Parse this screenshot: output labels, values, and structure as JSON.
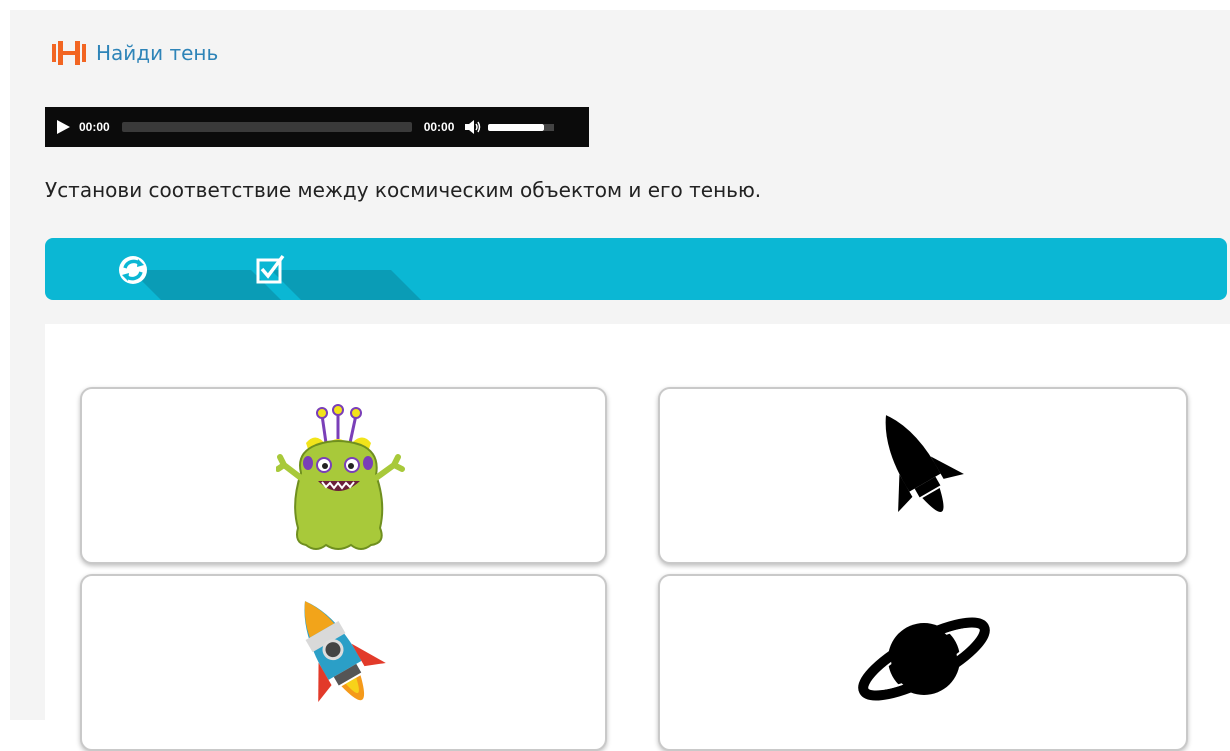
{
  "header": {
    "title": "Найди тень",
    "icon": "dumbbell-icon",
    "icon_color": "#f26522"
  },
  "audio": {
    "current_time": "00:00",
    "duration": "00:00",
    "volume_level": 0.85
  },
  "instruction": "Установи соответствие между космическим объектом и его тенью.",
  "toolbar": {
    "color": "#0bb7d4",
    "buttons": [
      {
        "icon": "refresh-icon"
      },
      {
        "icon": "checkbox-check-icon"
      }
    ]
  },
  "cards": [
    {
      "image": "alien-monster-image"
    },
    {
      "image": "rocket-shadow-image"
    },
    {
      "image": "rocket-color-image"
    },
    {
      "image": "saturn-shadow-image"
    }
  ]
}
